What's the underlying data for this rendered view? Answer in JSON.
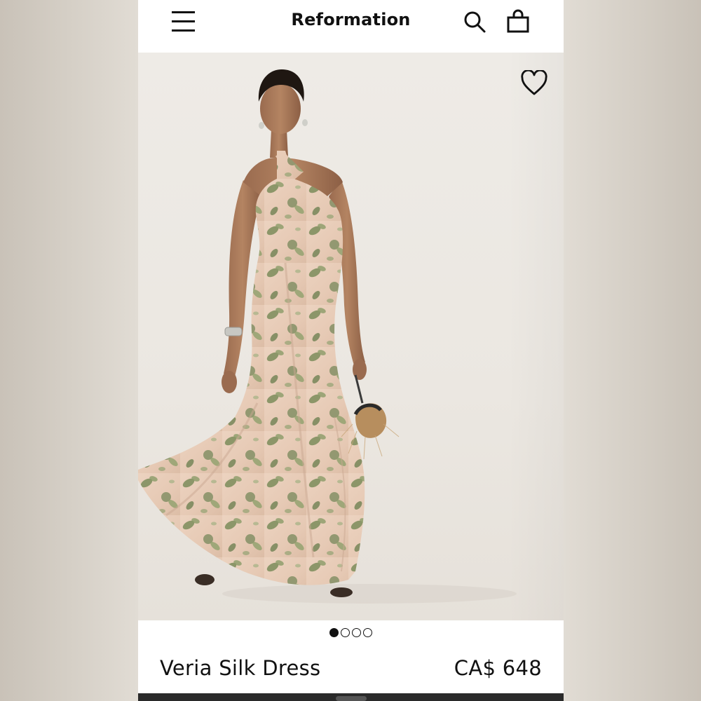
{
  "header": {
    "brand": "Reformation",
    "icons": [
      "menu-icon",
      "search-icon",
      "shopping-bag-icon"
    ]
  },
  "hero": {
    "favorite_icon": "heart-outline-icon",
    "carousel": {
      "total": 4,
      "active": 1
    }
  },
  "product": {
    "name": "Veria Silk Dress",
    "price": "CA$ 648"
  },
  "colors": {
    "text": "#111111",
    "background": "#ffffff",
    "hero_background": "#ece8e2",
    "dress_base": "#e9cdb9",
    "dress_print": "#7e8f5f"
  }
}
